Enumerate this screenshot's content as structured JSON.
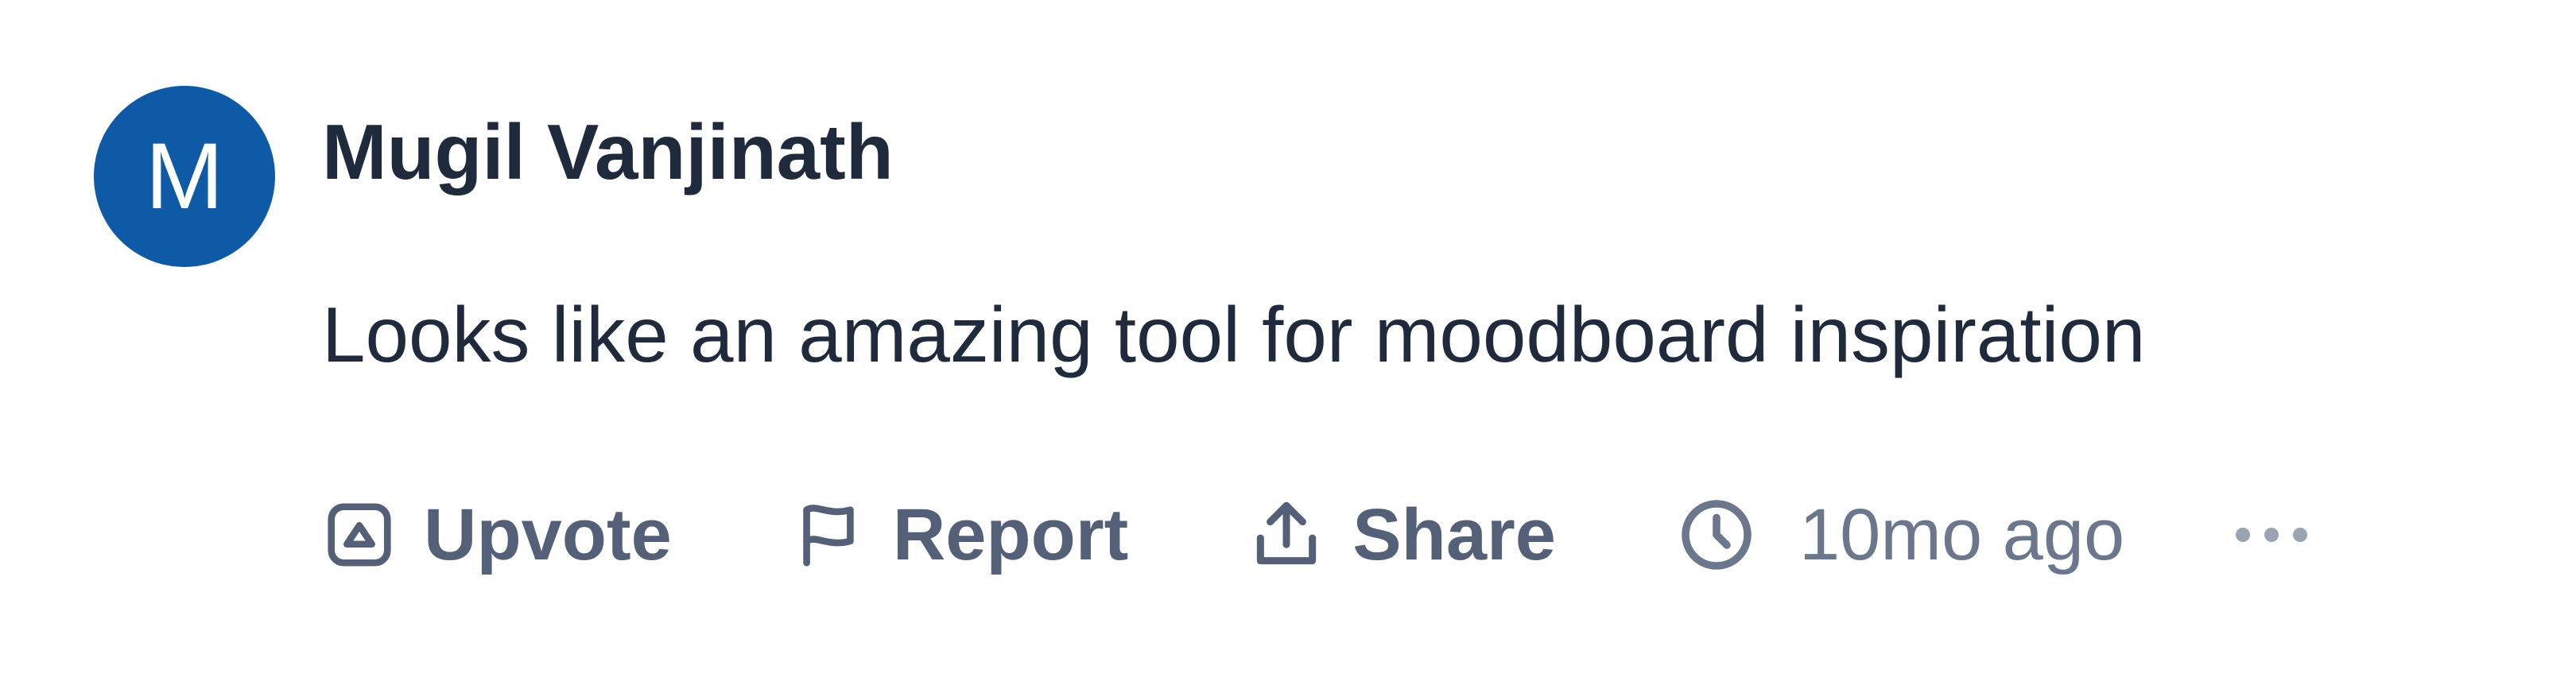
{
  "colors": {
    "avatar_bg": "#0f5aa6",
    "text_primary": "#1f2a3c",
    "action_text": "#536078",
    "time_text": "#6b778c",
    "more_text": "#9aa3b2"
  },
  "comment": {
    "avatar_initial": "M",
    "author": "Mugil Vanjinath",
    "text": "Looks like an amazing tool for moodboard inspiration"
  },
  "actions": {
    "upvote": {
      "label": "Upvote",
      "icon": "upvote-icon"
    },
    "report": {
      "label": "Report",
      "icon": "flag-icon"
    },
    "share": {
      "label": "Share",
      "icon": "share-icon"
    },
    "time": {
      "label": "10mo ago",
      "icon": "clock-icon"
    },
    "more": {
      "icon": "more-icon"
    }
  }
}
